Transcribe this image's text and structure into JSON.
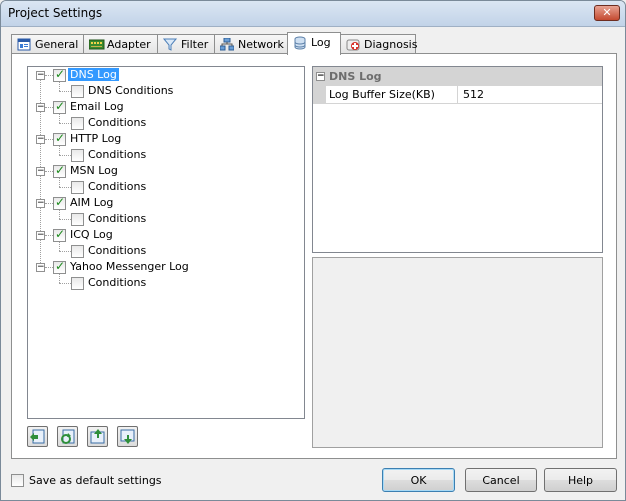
{
  "window": {
    "title": "Project Settings",
    "close_glyph": "✕"
  },
  "tabs": [
    {
      "label": "General",
      "icon": "general-icon"
    },
    {
      "label": "Adapter",
      "icon": "adapter-icon"
    },
    {
      "label": "Filter",
      "icon": "filter-funnel-icon"
    },
    {
      "label": "Network",
      "icon": "network-icon"
    },
    {
      "label": "Log",
      "icon": "log-icon",
      "active": true
    },
    {
      "label": "Diagnosis",
      "icon": "diagnosis-icon"
    }
  ],
  "tree": {
    "items": [
      {
        "label": "DNS Log",
        "checked": true,
        "selected": true,
        "child": {
          "label": "DNS Conditions",
          "checked": false
        }
      },
      {
        "label": "Email Log",
        "checked": true,
        "child": {
          "label": "Conditions",
          "checked": false
        }
      },
      {
        "label": "HTTP Log",
        "checked": true,
        "child": {
          "label": "Conditions",
          "checked": false
        }
      },
      {
        "label": "MSN Log",
        "checked": true,
        "child": {
          "label": "Conditions",
          "checked": false
        }
      },
      {
        "label": "AIM Log",
        "checked": true,
        "child": {
          "label": "Conditions",
          "checked": false
        }
      },
      {
        "label": "ICQ Log",
        "checked": true,
        "child": {
          "label": "Conditions",
          "checked": false
        }
      },
      {
        "label": "Yahoo Messenger Log",
        "checked": true,
        "child": {
          "label": "Conditions",
          "checked": false
        }
      }
    ],
    "expander_glyph": "−"
  },
  "properties": {
    "category": "DNS Log",
    "rows": [
      {
        "name": "Log Buffer Size(KB)",
        "value": "512"
      }
    ]
  },
  "tool_buttons": [
    {
      "icon": "import-icon"
    },
    {
      "icon": "refresh-icon"
    },
    {
      "icon": "move-up-icon"
    },
    {
      "icon": "move-down-icon"
    }
  ],
  "footer": {
    "save_default_label": "Save as default settings",
    "save_default_checked": false,
    "ok_label": "OK",
    "cancel_label": "Cancel",
    "help_label": "Help"
  },
  "colors": {
    "selection": "#3399ff",
    "check": "#1c8a1c"
  }
}
